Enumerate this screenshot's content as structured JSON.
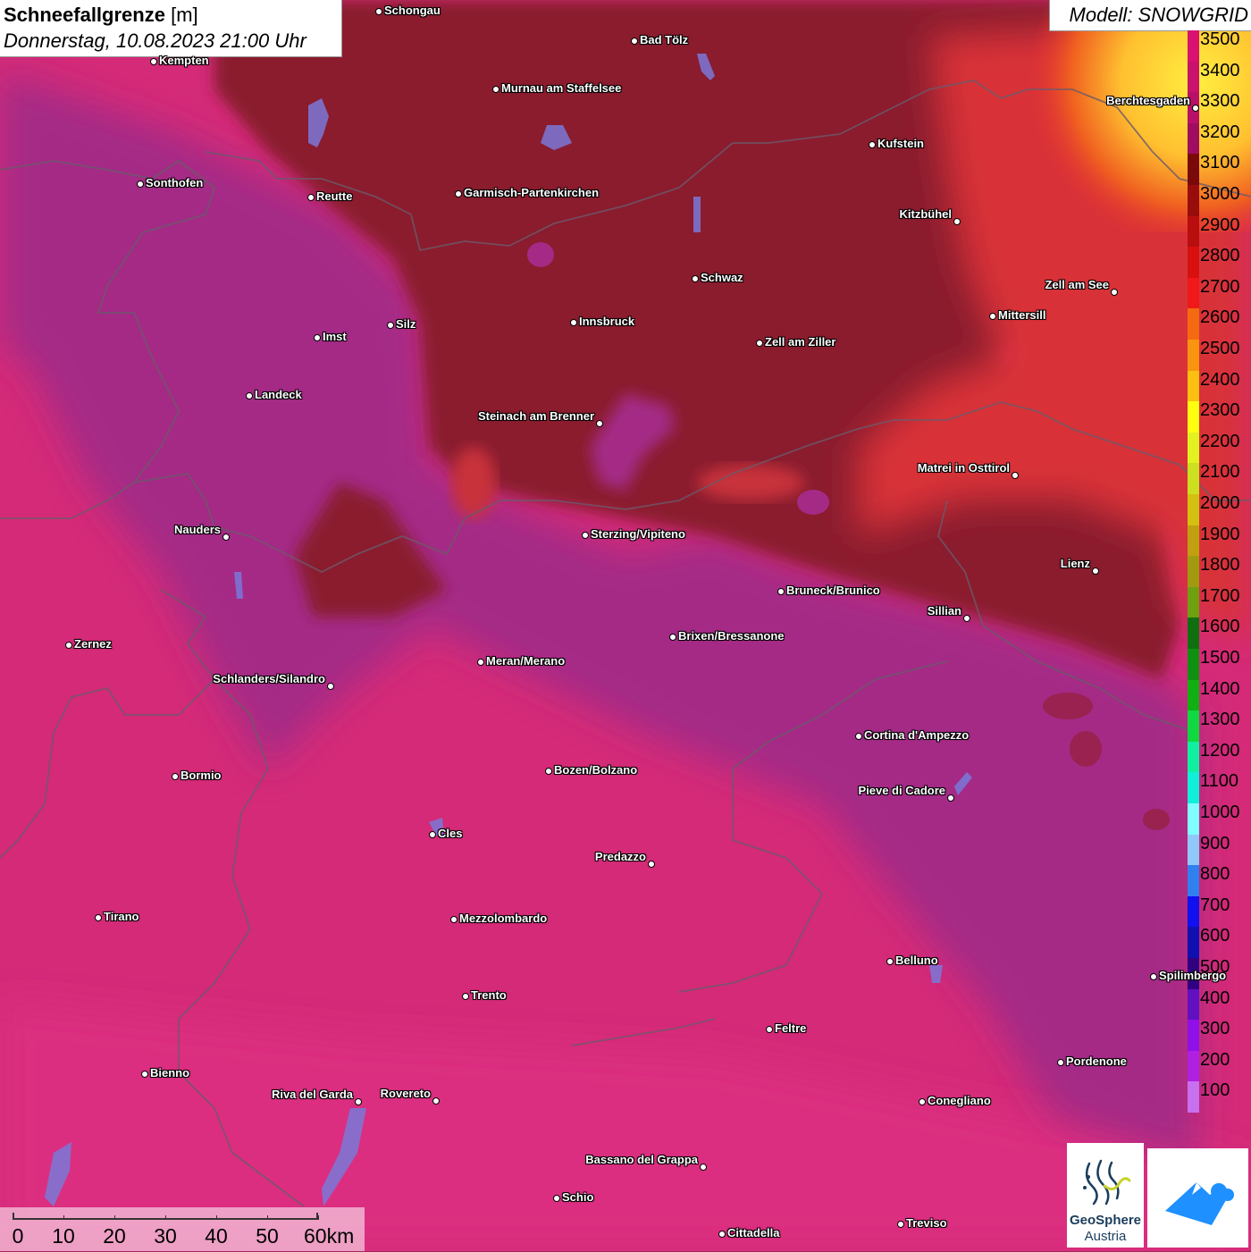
{
  "title": {
    "main": "Schneefallgrenze",
    "unit": "[m]",
    "datetime": "Donnerstag, 10.08.2023 21:00 Uhr"
  },
  "model": {
    "label": "Modell: SNOWGRID"
  },
  "legend": {
    "levels": [
      {
        "label": "3500",
        "color": "#d8126e"
      },
      {
        "label": "3400",
        "color": "#c8126c"
      },
      {
        "label": "3300",
        "color": "#b81068"
      },
      {
        "label": "3200",
        "color": "#a00c60"
      },
      {
        "label": "3100",
        "color": "#7a0a0a"
      },
      {
        "label": "3000",
        "color": "#980c0c"
      },
      {
        "label": "2900",
        "color": "#b80e0e"
      },
      {
        "label": "2800",
        "color": "#d81010"
      },
      {
        "label": "2700",
        "color": "#f01818"
      },
      {
        "label": "2600",
        "color": "#f46a10"
      },
      {
        "label": "2500",
        "color": "#f89410"
      },
      {
        "label": "2400",
        "color": "#fbc010"
      },
      {
        "label": "2300",
        "color": "#fefe10"
      },
      {
        "label": "2200",
        "color": "#e2f220"
      },
      {
        "label": "2100",
        "color": "#cce020"
      },
      {
        "label": "2000",
        "color": "#d4c010"
      },
      {
        "label": "1900",
        "color": "#c0a010"
      },
      {
        "label": "1800",
        "color": "#a09a10"
      },
      {
        "label": "1700",
        "color": "#6ea010"
      },
      {
        "label": "1600",
        "color": "#107010"
      },
      {
        "label": "1500",
        "color": "#109010"
      },
      {
        "label": "1400",
        "color": "#10b010"
      },
      {
        "label": "1300",
        "color": "#10d840"
      },
      {
        "label": "1200",
        "color": "#10f0a0"
      },
      {
        "label": "1100",
        "color": "#10f0d8"
      },
      {
        "label": "1000",
        "color": "#80ffff"
      },
      {
        "label": "900",
        "color": "#90c8f8"
      },
      {
        "label": "800",
        "color": "#3080f0"
      },
      {
        "label": "700",
        "color": "#1010f0"
      },
      {
        "label": "600",
        "color": "#1010b0"
      },
      {
        "label": "500",
        "color": "#300080"
      },
      {
        "label": "400",
        "color": "#6010c0"
      },
      {
        "label": "300",
        "color": "#9010e8"
      },
      {
        "label": "200",
        "color": "#b020e0"
      },
      {
        "label": "100",
        "color": "#c870f0"
      }
    ]
  },
  "cities": [
    {
      "name": "Schongau",
      "side": "r"
    },
    {
      "name": "Bad Tölz",
      "side": "r"
    },
    {
      "name": "Kempten",
      "side": "r"
    },
    {
      "name": "Murnau am Staffelsee",
      "side": "r"
    },
    {
      "name": "Kufstein",
      "side": "r"
    },
    {
      "name": "Berchtesgaden",
      "side": "l"
    },
    {
      "name": "Sonthofen",
      "side": "r"
    },
    {
      "name": "Reutte",
      "side": "r"
    },
    {
      "name": "Garmisch-Partenkirchen",
      "side": "r"
    },
    {
      "name": "Kitzbühel",
      "side": "l"
    },
    {
      "name": "Schwaz",
      "side": "r"
    },
    {
      "name": "Zell am See",
      "side": "l"
    },
    {
      "name": "Mittersill",
      "side": "r"
    },
    {
      "name": "Silz",
      "side": "r"
    },
    {
      "name": "Innsbruck",
      "side": "r"
    },
    {
      "name": "Imst",
      "side": "r"
    },
    {
      "name": "Zell am Ziller",
      "side": "r"
    },
    {
      "name": "Landeck",
      "side": "r"
    },
    {
      "name": "Steinach am Brenner",
      "side": "l"
    },
    {
      "name": "Matrei in Osttirol",
      "side": "l"
    },
    {
      "name": "Nauders",
      "side": "l"
    },
    {
      "name": "Sterzing/Vipiteno",
      "side": "r"
    },
    {
      "name": "Lienz",
      "side": "l"
    },
    {
      "name": "Bruneck/Brunico",
      "side": "r"
    },
    {
      "name": "Sillian",
      "side": "l"
    },
    {
      "name": "Zernez",
      "side": "r"
    },
    {
      "name": "Brixen/Bressanone",
      "side": "r"
    },
    {
      "name": "Meran/Merano",
      "side": "r"
    },
    {
      "name": "Schlanders/Silandro",
      "side": "l"
    },
    {
      "name": "Cortina d'Ampezzo",
      "side": "r"
    },
    {
      "name": "Bozen/Bolzano",
      "side": "r"
    },
    {
      "name": "Bormio",
      "side": "r"
    },
    {
      "name": "Pieve di Cadore",
      "side": "l"
    },
    {
      "name": "Cles",
      "side": "r"
    },
    {
      "name": "Predazzo",
      "side": "l"
    },
    {
      "name": "Tirano",
      "side": "r"
    },
    {
      "name": "Mezzolombardo",
      "side": "r"
    },
    {
      "name": "Belluno",
      "side": "r"
    },
    {
      "name": "Spilimbergo",
      "side": "r"
    },
    {
      "name": "Trento",
      "side": "r"
    },
    {
      "name": "Feltre",
      "side": "r"
    },
    {
      "name": "Pordenone",
      "side": "r"
    },
    {
      "name": "Bienno",
      "side": "r"
    },
    {
      "name": "Riva del Garda",
      "side": "l"
    },
    {
      "name": "Rovereto",
      "side": "l"
    },
    {
      "name": "Conegliano",
      "side": "r"
    },
    {
      "name": "Bassano del Grappa",
      "side": "l"
    },
    {
      "name": "Schio",
      "side": "r"
    },
    {
      "name": "Treviso",
      "side": "r"
    },
    {
      "name": "Cittadella",
      "side": "r"
    }
  ],
  "scale": {
    "labels": [
      "0",
      "10",
      "20",
      "30",
      "40",
      "50",
      "60km"
    ]
  },
  "logo": {
    "name_line1": "GeoSphere",
    "name_line2": "Austria",
    "brand_color": "#1a3d5c",
    "accent_color": "#1e90ff"
  }
}
